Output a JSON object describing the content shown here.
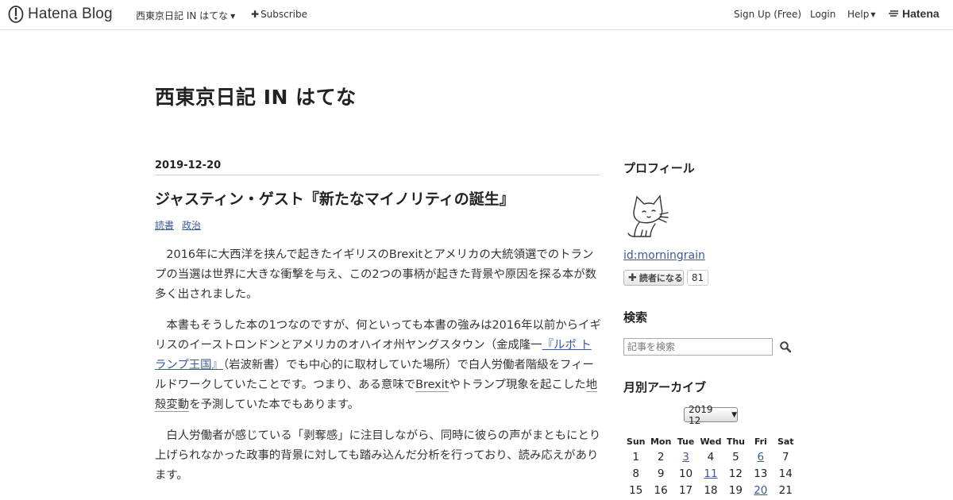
{
  "header": {
    "logo_text": "Hatena Blog",
    "blog_name": "西東京日記 IN はてな",
    "subscribe": "Subscribe",
    "signup": "Sign Up (Free)",
    "login": "Login",
    "help": "Help",
    "hatena": "Hatena"
  },
  "blog": {
    "title": "西東京日記 IN はてな"
  },
  "entry": {
    "date": "2019-12-20",
    "title": "ジャスティン・ゲスト『新たなマイノリティの誕生』",
    "categories": [
      "読書",
      "政治"
    ],
    "p1": "2016年に大西洋を挟んで起きたイギリスのBrexitとアメリカの大統領選でのトランプの当選は世界に大きな衝撃を与え、この2つの事柄が起きた背景や原因を探る本が数多く出されました。",
    "p2a": "本書もそうした本の1つなのですが、何といっても本書の強みは2016年以前からイギリスのイーストロンドンとアメリカのオハイオ州ヤングスタウン（金成隆一",
    "p2_link": "『ルポ トランプ王国』",
    "p2b": "（岩波新書）でも中心的に取材していた場所）で白人労働者階級をフィールドワークしていたことです。つまり、ある意味で",
    "p2_kw1": "Brexit",
    "p2c": "やトランプ現象を起こした",
    "p2_kw2": "地殻変動",
    "p2d": "を予測していた本でもあります。",
    "p3": "白人労働者が感じている「剥奪感」に注目しながら、同時に彼らの声がまともにとり上げられなかった政事的背景に対しても踏み込んだ分析を行っており、読み応えがあります。"
  },
  "sidebar": {
    "profile_heading": "プロフィール",
    "profile_id": "id:morningrain",
    "subscribe_label": "読者になる",
    "subscriber_count": "81",
    "search_heading": "検索",
    "search_placeholder": "記事を検索",
    "archive_heading": "月別アーカイブ",
    "archive_selected": "2019 12",
    "calendar": {
      "weekdays": [
        "Sun",
        "Mon",
        "Tue",
        "Wed",
        "Thu",
        "Fri",
        "Sat"
      ],
      "rows": [
        [
          "1",
          "2",
          "3",
          "4",
          "5",
          "6",
          "7"
        ],
        [
          "8",
          "9",
          "10",
          "11",
          "12",
          "13",
          "14"
        ],
        [
          "15",
          "16",
          "17",
          "18",
          "19",
          "20",
          "21"
        ]
      ],
      "linked_days": [
        "3",
        "6",
        "11",
        "20"
      ]
    }
  }
}
